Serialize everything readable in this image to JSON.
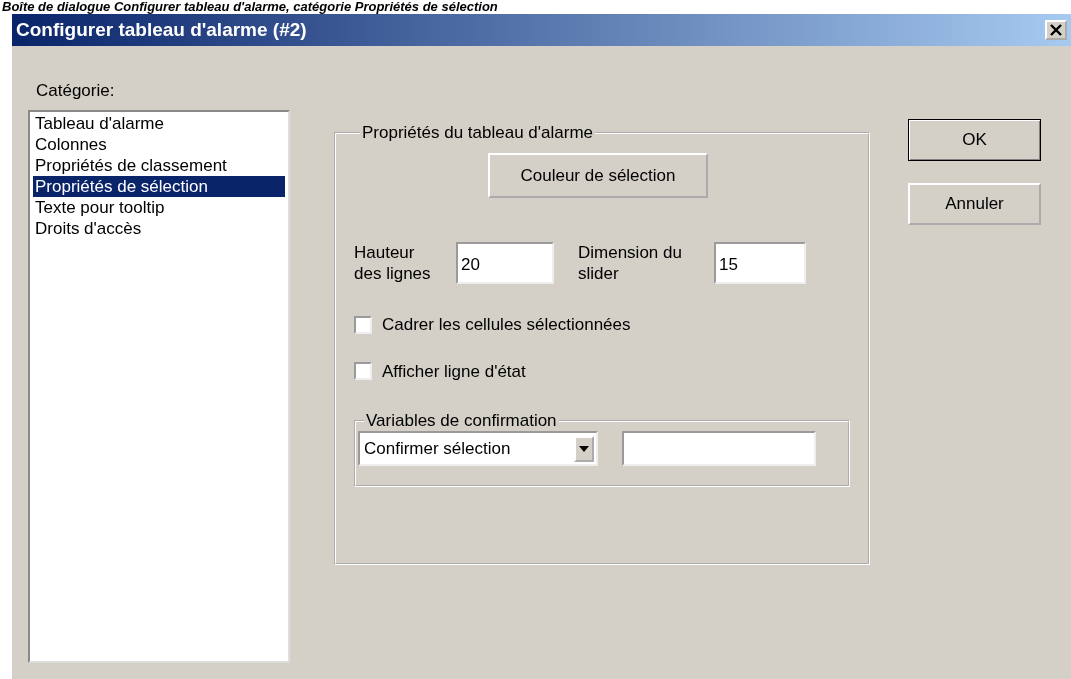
{
  "caption": "Boîte de dialogue Configurer tableau d'alarme, catégorie Propriétés de sélection",
  "window": {
    "title": "Configurer tableau d'alarme (#2)"
  },
  "category": {
    "label": "Catégorie:",
    "items": [
      {
        "label": "Tableau d'alarme",
        "selected": false
      },
      {
        "label": "Colonnes",
        "selected": false
      },
      {
        "label": "Propriétés de classement",
        "selected": false
      },
      {
        "label": "Propriétés de sélection",
        "selected": true
      },
      {
        "label": "Texte pour tooltip",
        "selected": false
      },
      {
        "label": "Droits d'accès",
        "selected": false
      }
    ]
  },
  "group": {
    "title": "Propriétés du tableau d'alarme",
    "color_button": "Couleur de sélection",
    "fields": [
      {
        "label": "Hauteur des lignes",
        "value": "20"
      },
      {
        "label": "Dimension du slider",
        "value": "15"
      }
    ],
    "checkboxes": [
      {
        "label": "Cadrer les cellules sélectionnées",
        "checked": false
      },
      {
        "label": "Afficher ligne d'état",
        "checked": false
      }
    ],
    "confirm": {
      "title": "Variables de confirmation",
      "dropdown": "Confirmer sélection"
    }
  },
  "buttons": [
    "OK",
    "Annuler"
  ]
}
